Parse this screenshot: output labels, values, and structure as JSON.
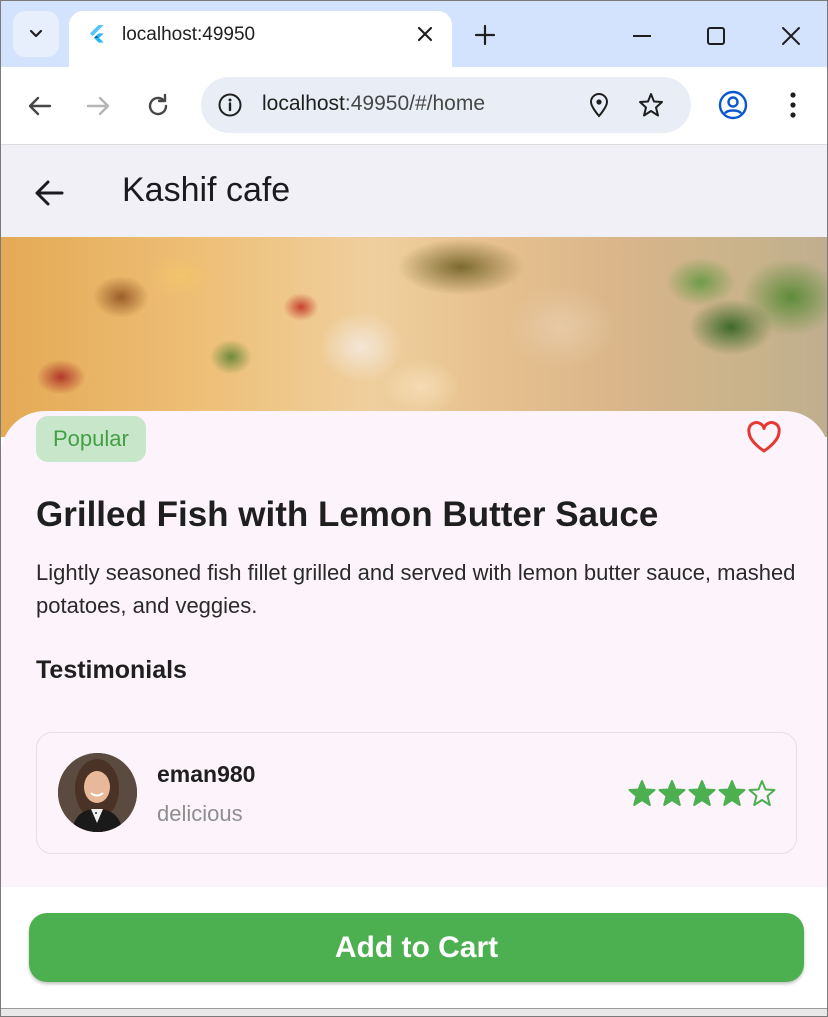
{
  "browser": {
    "tab_title": "localhost:49950",
    "url_host": "localhost",
    "url_path": ":49950/#/home"
  },
  "app": {
    "title": "Kashif cafe"
  },
  "dish": {
    "badge": "Popular",
    "name": "Grilled Fish with Lemon Butter Sauce",
    "description": "Lightly seasoned fish fillet grilled and served with lemon butter sauce, mashed potatoes, and veggies.",
    "favorite": false
  },
  "testimonials": {
    "heading": "Testimonials",
    "items": [
      {
        "user": "eman980",
        "comment": "delicious",
        "rating": 4,
        "max_rating": 5
      }
    ]
  },
  "actions": {
    "add_to_cart": "Add to Cart"
  },
  "colors": {
    "accent": "#4caf50",
    "badge_bg": "#c8e6c9",
    "badge_text": "#43a047",
    "heart": "#e53935",
    "star": "#4caf50"
  }
}
